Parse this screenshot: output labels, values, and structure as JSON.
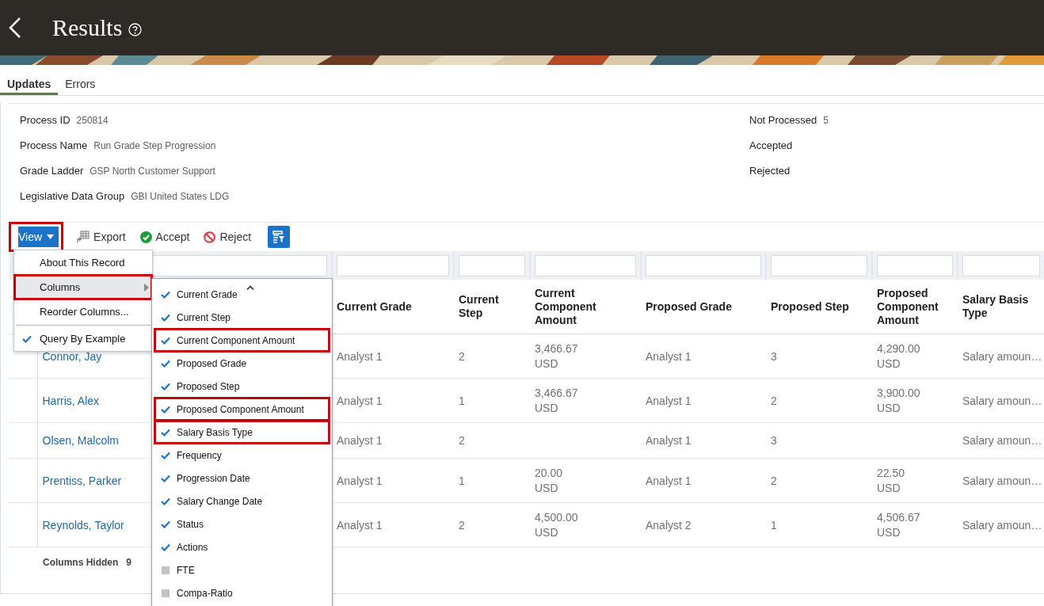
{
  "header": {
    "title": "Results"
  },
  "tabs": [
    {
      "label": "Updates",
      "selected": true
    },
    {
      "label": "Errors",
      "selected": false
    }
  ],
  "details_left": [
    {
      "label": "Process ID",
      "value": "250814"
    },
    {
      "label": "Process Name",
      "value": "Run Grade Step Progression"
    },
    {
      "label": "Grade Ladder",
      "value": "GSP North Customer Support"
    },
    {
      "label": "Legislative Data Group",
      "value": "GBI United States LDG"
    }
  ],
  "details_right": [
    {
      "label": "Not Processed",
      "value": "5"
    },
    {
      "label": "Accepted"
    },
    {
      "label": "Rejected"
    }
  ],
  "toolbar": {
    "view": {
      "label": "View",
      "highlighted": true
    },
    "actions": [
      {
        "kind": "export",
        "label": "Export"
      },
      {
        "kind": "accept",
        "label": "Accept"
      },
      {
        "kind": "reject",
        "label": "Reject"
      }
    ]
  },
  "table": {
    "columns": [
      "Current Grade",
      "Current Step",
      "Current Component Amount",
      "Proposed Grade",
      "Proposed Step",
      "Proposed Component Amount",
      "Salary Basis Type"
    ],
    "rows": [
      {
        "name": "Connor, Jay",
        "current_grade": "Analyst 1",
        "current_step": "2",
        "current_amount": "3,466.67",
        "current_currency": "USD",
        "proposed_grade": "Analyst 1",
        "proposed_step": "3",
        "proposed_amount": "4,290.00",
        "proposed_currency": "USD",
        "salary_basis_type": "Salary amoun…"
      },
      {
        "name": "Harris, Alex",
        "current_grade": "Analyst 1",
        "current_step": "1",
        "current_amount": "3,466.67",
        "current_currency": "USD",
        "proposed_grade": "Analyst 1",
        "proposed_step": "2",
        "proposed_amount": "3,900.00",
        "proposed_currency": "USD",
        "salary_basis_type": "Salary amoun…"
      },
      {
        "name": "Olsen, Malcolm",
        "current_grade": "Analyst 1",
        "current_step": "2",
        "proposed_grade": "Analyst 1",
        "proposed_step": "3",
        "salary_basis_type": "Salary amoun…"
      },
      {
        "name": "Prentiss, Parker",
        "current_grade": "Analyst 1",
        "current_step": "1",
        "current_amount": "20.00",
        "current_currency": "USD",
        "proposed_grade": "Analyst 1",
        "proposed_step": "2",
        "proposed_amount": "22.50",
        "proposed_currency": "USD",
        "salary_basis_type": "Salary amoun…"
      },
      {
        "name": "Reynolds, Taylor",
        "current_grade": "Analyst 1",
        "current_step": "2",
        "current_amount": "4,500.00",
        "current_currency": "USD",
        "proposed_grade": "Analyst 2",
        "proposed_step": "1",
        "proposed_amount": "4,506.67",
        "proposed_currency": "USD",
        "salary_basis_type": "Salary amoun…"
      }
    ],
    "footer": {
      "label": "Columns Hidden",
      "value": "9"
    }
  },
  "view_menu": {
    "groups": [
      [
        {
          "kind": "action",
          "label": "About This Record",
          "expanded": false,
          "checked": false,
          "highlighted": false
        },
        {
          "kind": "submenu",
          "label": "Columns",
          "expanded": true,
          "checked": false,
          "highlighted": true
        },
        {
          "kind": "action",
          "label": "Reorder Columns...",
          "expanded": false,
          "checked": false,
          "highlighted": false
        }
      ],
      [
        {
          "kind": "toggle",
          "label": "Query By Example",
          "expanded": false,
          "checked": true,
          "highlighted": false
        }
      ]
    ]
  },
  "columns_menu": {
    "items": [
      {
        "label": "Current Grade",
        "checked": true,
        "highlighted": false
      },
      {
        "label": "Current Step",
        "checked": true,
        "highlighted": false
      },
      {
        "label": "Current Component Amount",
        "checked": true,
        "highlighted": true
      },
      {
        "label": "Proposed Grade",
        "checked": true,
        "highlighted": false
      },
      {
        "label": "Proposed Step",
        "checked": true,
        "highlighted": false
      },
      {
        "label": "Proposed Component Amount",
        "checked": true,
        "highlighted": true
      },
      {
        "label": "Salary Basis Type",
        "checked": true,
        "highlighted": true
      },
      {
        "label": "Frequency",
        "checked": true,
        "highlighted": false
      },
      {
        "label": "Progression Date",
        "checked": true,
        "highlighted": false
      },
      {
        "label": "Salary Change Date",
        "checked": true,
        "highlighted": false
      },
      {
        "label": "Status",
        "checked": true,
        "highlighted": false
      },
      {
        "label": "Actions",
        "checked": true,
        "highlighted": false
      },
      {
        "label": "FTE",
        "checked": false,
        "highlighted": false
      },
      {
        "label": "Compa-Ratio",
        "checked": false,
        "highlighted": false
      }
    ]
  }
}
